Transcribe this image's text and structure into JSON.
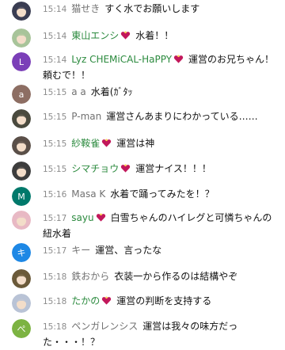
{
  "messages": [
    {
      "time": "15:14",
      "author": "猫せき",
      "member": false,
      "badge": false,
      "text": "すく水でお願いします",
      "avatar_icon": "anime-avatar-icon",
      "avatar_color": "#3a3d52"
    },
    {
      "time": "15:14",
      "author": "東山エンシ",
      "member": true,
      "badge": true,
      "text": "水着！！",
      "avatar_icon": "anime-avatar-icon",
      "avatar_color": "#a8c49a"
    },
    {
      "time": "15:14",
      "author": "Lyz CHEMiCAL-HaPPY",
      "member": true,
      "badge": true,
      "text": "運営のお兄ちゃん！頼むで！！",
      "avatar_icon": "letter-avatar-icon",
      "avatar_color": "#7b3fb8",
      "avatar_letter": "L"
    },
    {
      "time": "15:15",
      "author": "a a",
      "member": false,
      "badge": false,
      "text": "水着(ｶﾞﾀｯ",
      "avatar_icon": "letter-avatar-icon",
      "avatar_color": "#8d6e63",
      "avatar_letter": "a"
    },
    {
      "time": "15:15",
      "author": "P-man",
      "member": false,
      "badge": false,
      "text": "運営さんあまりにわかっている……",
      "avatar_icon": "anime-avatar-icon",
      "avatar_color": "#4a4a3e"
    },
    {
      "time": "15:15",
      "author": "紗鞍雀",
      "member": true,
      "badge": true,
      "text": "運営は神",
      "avatar_icon": "anime-avatar-icon",
      "avatar_color": "#5a4f48"
    },
    {
      "time": "15:15",
      "author": "シマチョウ",
      "member": true,
      "badge": true,
      "text": "運営ナイス！！！",
      "avatar_icon": "anime-avatar-icon",
      "avatar_color": "#3d3d3d"
    },
    {
      "time": "15:16",
      "author": "Masa K",
      "member": false,
      "badge": false,
      "text": "水着で踊ってみたを！？",
      "avatar_icon": "letter-avatar-icon",
      "avatar_color": "#00796b",
      "avatar_letter": "M"
    },
    {
      "time": "15:17",
      "author": "sayu",
      "member": true,
      "badge": true,
      "text": "白雪ちゃんのハイレグと可憐ちゃんの紐水着",
      "avatar_icon": "anime-avatar-icon",
      "avatar_color": "#e8b9c4"
    },
    {
      "time": "15:17",
      "author": "キー",
      "member": false,
      "badge": false,
      "text": "運営、言ったな",
      "avatar_icon": "letter-avatar-icon",
      "avatar_color": "#1e88e5",
      "avatar_letter": "キ"
    },
    {
      "time": "15:18",
      "author": "鉄おから",
      "member": false,
      "badge": false,
      "text": "衣装一から作るのは結構やぞ",
      "avatar_icon": "anime-avatar-icon",
      "avatar_color": "#6b5a3a"
    },
    {
      "time": "15:18",
      "author": "たかの",
      "member": true,
      "badge": true,
      "text": "運営の判断を支持する",
      "avatar_icon": "anime-avatar-icon",
      "avatar_color": "#b9c3d6"
    },
    {
      "time": "15:18",
      "author": "ペンガレンシス",
      "member": false,
      "badge": false,
      "text": "運営は我々の味方だった・・・！？",
      "avatar_icon": "letter-avatar-icon",
      "avatar_color": "#7cb342",
      "avatar_letter": "ぺ"
    }
  ],
  "badge_color": "#c2185b"
}
